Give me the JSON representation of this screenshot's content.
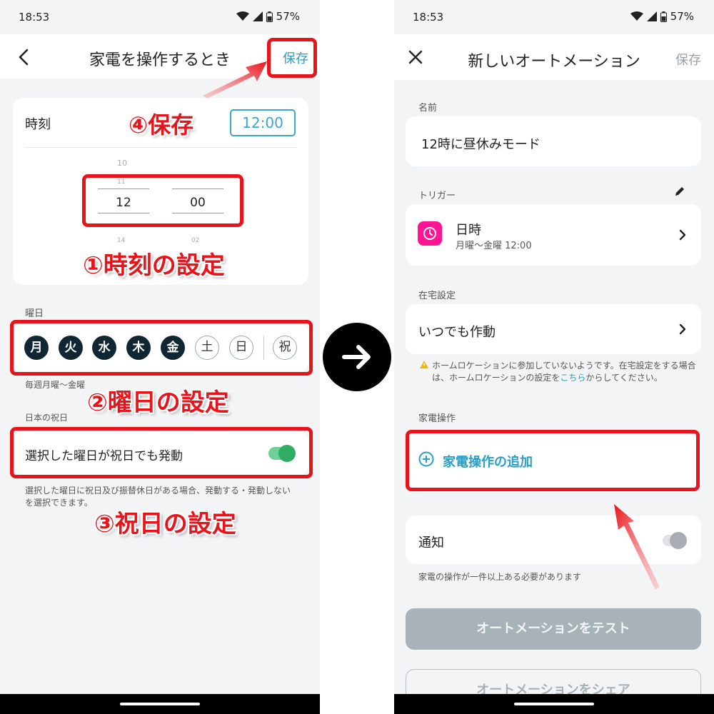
{
  "left": {
    "status": {
      "time": "18:53",
      "battery": "57%"
    },
    "title": "家電を操作するとき",
    "save_label": "保存",
    "time_label": "時刻",
    "time_value": "12:00",
    "picker": {
      "hour_above": "10",
      "hour_above2": "11",
      "hour": "12",
      "hour_below": "14",
      "minute": "00",
      "minute_below": "02"
    },
    "weekday_label": "曜日",
    "days": [
      "月",
      "火",
      "水",
      "木",
      "金",
      "土",
      "日"
    ],
    "holiday_day": "祝",
    "weekday_summary": "毎週月曜〜金曜",
    "holiday_section_label": "日本の祝日",
    "holiday_toggle_label": "選択した曜日が祝日でも発動",
    "holiday_hint": "選択した曜日に祝日及び振替休日がある場合、発動する・発動しないを選択できます。",
    "annotations": {
      "a1": "①時刻の設定",
      "a2": "②曜日の設定",
      "a3": "③祝日の設定",
      "a4": "④保存"
    }
  },
  "right": {
    "status": {
      "time": "18:53",
      "battery": "57%"
    },
    "title": "新しいオートメーション",
    "save_label": "保存",
    "name_label": "名前",
    "name_value": "12時に昼休みモード",
    "trigger_label": "トリガー",
    "trigger_title": "日時",
    "trigger_sub": "月曜〜金曜 12:00",
    "presence_label": "在宅設定",
    "presence_value": "いつでも作動",
    "warning_text_1": "ホームロケーションに参加していないようです。在宅設定をする場合は、ホームロケーションの設定を",
    "warning_link": "こちら",
    "warning_text_2": "からしてください。",
    "appliance_label": "家電操作",
    "add_appliance": "家電操作の追加",
    "notify_label": "通知",
    "notify_hint": "家電の操作が一件以上ある必要があります",
    "test_button": "オートメーションをテスト",
    "share_button": "オートメーションをシェア"
  },
  "colors": {
    "accent": "#2a9fc4",
    "annotation_red": "#e8141b",
    "day_on": "#0f2633",
    "toggle_on": "#2fae63",
    "trigger_icon": "#ff1493"
  }
}
